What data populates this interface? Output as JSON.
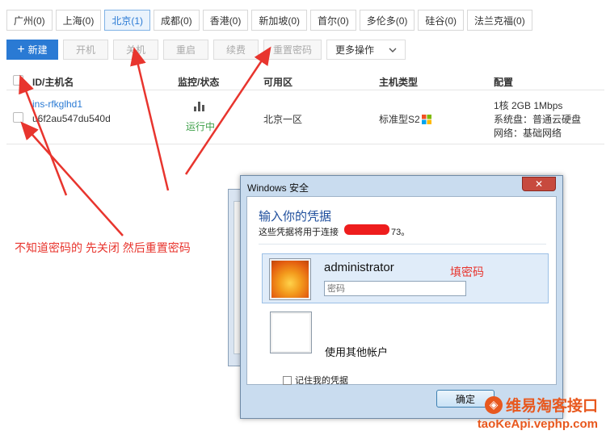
{
  "regions": [
    {
      "label": "广州(0)"
    },
    {
      "label": "上海(0)"
    },
    {
      "label": "北京(1)",
      "active": true
    },
    {
      "label": "成都(0)"
    },
    {
      "label": "香港(0)"
    },
    {
      "label": "新加坡(0)"
    },
    {
      "label": "首尔(0)"
    },
    {
      "label": "多伦多(0)"
    },
    {
      "label": "硅谷(0)"
    },
    {
      "label": "法兰克福(0)"
    }
  ],
  "toolbar": {
    "new_label": "新建",
    "start_label": "开机",
    "stop_label": "关机",
    "restart_label": "重启",
    "renew_label": "续费",
    "reset_pwd_label": "重置密码",
    "more_label": "更多操作"
  },
  "table": {
    "headers": {
      "id": "ID/主机名",
      "status": "监控/状态",
      "zone": "可用区",
      "type": "主机类型",
      "config": "配置"
    },
    "row": {
      "id": "ins-rfkglhd1",
      "hostname": "u6f2au547du540d",
      "status": "运行中",
      "zone": "北京一区",
      "type": "标准型S2",
      "config_cpu": "1核 2GB 1Mbps",
      "config_disk": "系统盘：普通云硬盘",
      "config_net": "网络：基础网络"
    }
  },
  "annotations": {
    "left_note": "不知道密码的   先关闭   然后重置密码",
    "fill_password": "填密码"
  },
  "dialog": {
    "title": "Windows 安全",
    "heading": "输入你的凭据",
    "subtitle": "这些凭据将用于连接",
    "subtitle_tail": "73。",
    "username": "administrator",
    "password_placeholder": "密码",
    "other_account": "使用其他帐户",
    "remember": "记住我的凭据",
    "ok_label": "确定"
  },
  "watermark": {
    "title": "维易淘客接口",
    "url": "taoKeApi.vephp.com"
  },
  "colors": {
    "accent": "#2a7ad4",
    "status_ok": "#3fa14a",
    "annotation": "#e8352e"
  }
}
